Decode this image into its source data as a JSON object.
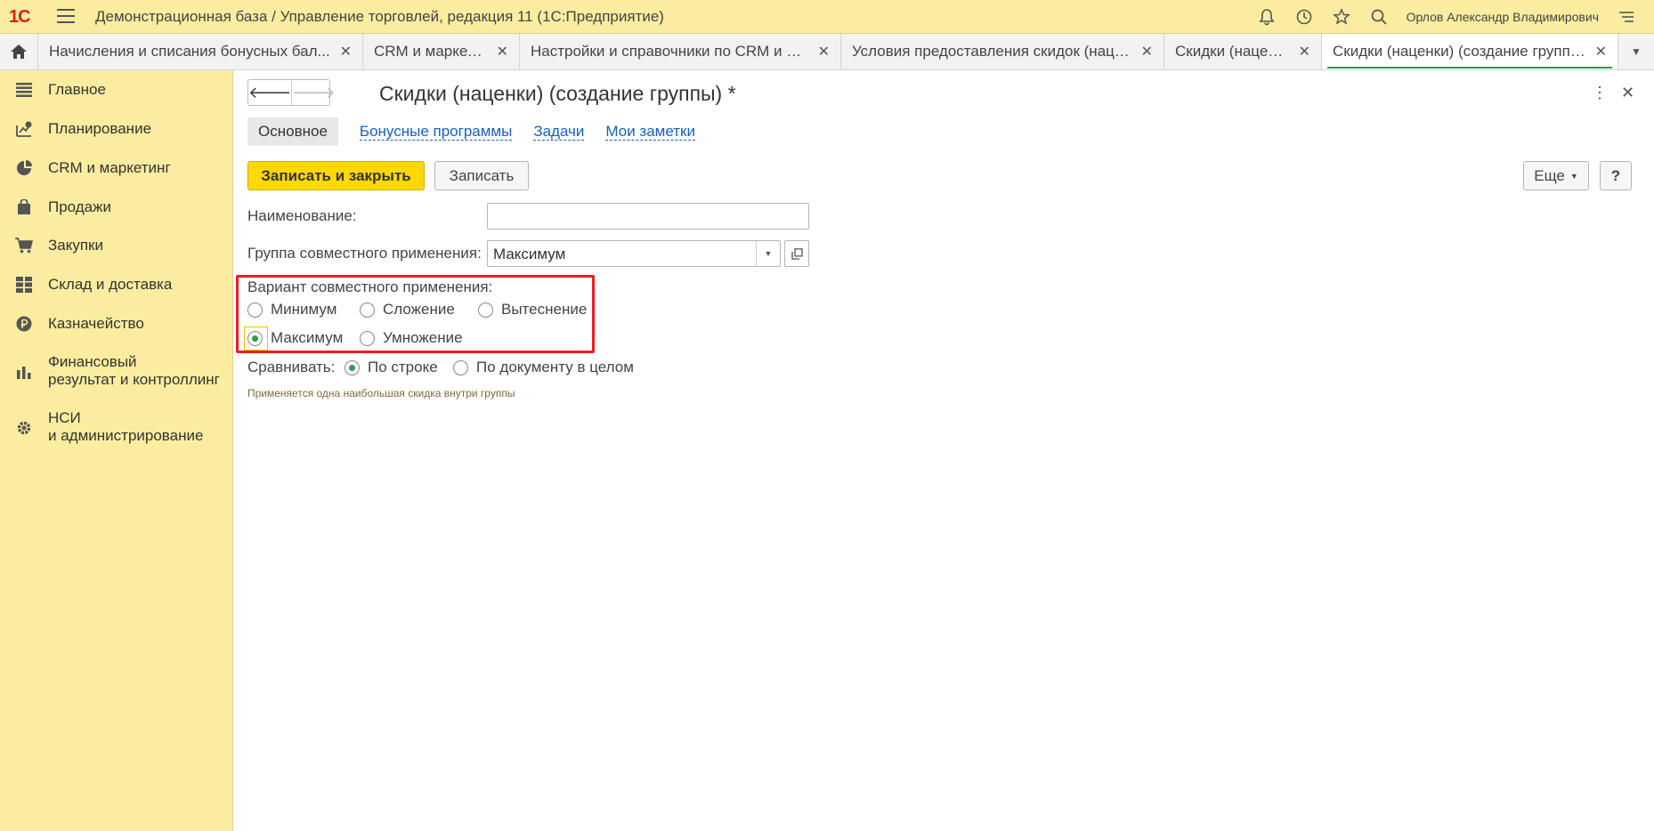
{
  "app": {
    "title": "Демонстрационная база / Управление торговлей, редакция 11   (1С:Предприятие)",
    "logo_text": "1С",
    "user": "Орлов Александр Владимирович"
  },
  "tabs": [
    {
      "label": "Начисления и списания бонусных бал..."
    },
    {
      "label": "CRM и маркетинг"
    },
    {
      "label": "Настройки и справочники по CRM и ма..."
    },
    {
      "label": "Условия предоставления скидок (наце..."
    },
    {
      "label": "Скидки (наценки)"
    },
    {
      "label": "Скидки (наценки) (создание группы) *"
    }
  ],
  "sidebar": {
    "items": [
      {
        "label": "Главное",
        "icon": "list-icon"
      },
      {
        "label": "Планирование",
        "icon": "planning-icon"
      },
      {
        "label": "CRM и маркетинг",
        "icon": "pie-chart-icon"
      },
      {
        "label": "Продажи",
        "icon": "shopping-bag-icon"
      },
      {
        "label": "Закупки",
        "icon": "cart-icon"
      },
      {
        "label": "Склад и доставка",
        "icon": "warehouse-icon"
      },
      {
        "label": "Казначейство",
        "icon": "ruble-icon"
      },
      {
        "label": "Финансовый\nрезультат и контроллинг",
        "icon": "bar-chart-icon"
      },
      {
        "label": "НСИ\nи администрирование",
        "icon": "gear-icon"
      }
    ]
  },
  "form": {
    "title": "Скидки (наценки) (создание группы) *",
    "sections": {
      "main": "Основное",
      "bonus": "Бонусные программы",
      "tasks": "Задачи",
      "notes": "Мои заметки"
    },
    "buttons": {
      "save_close": "Записать и закрыть",
      "save": "Записать",
      "more": "Еще",
      "help": "?"
    },
    "name_label": "Наименование:",
    "name_value": "",
    "group_label": "Группа совместного применения:",
    "group_value": "Максимум",
    "variant_label": "Вариант совместного применения:",
    "variants": {
      "min": "Минимум",
      "sum": "Сложение",
      "displace": "Вытеснение",
      "max": "Максимум",
      "mult": "Умножение"
    },
    "selected_variant": "Максимум",
    "compare_label": "Сравнивать:",
    "compare_row": "По строке",
    "compare_doc": "По документу в целом",
    "selected_compare": "По строке",
    "hint": "Применяется одна наибольшая скидка внутри группы"
  },
  "colors": {
    "panel": "#fbeda0",
    "accent": "#ffd800",
    "link": "#1560bd",
    "highlight": "#ee1b24",
    "radio_checked": "#2a9d4b"
  }
}
